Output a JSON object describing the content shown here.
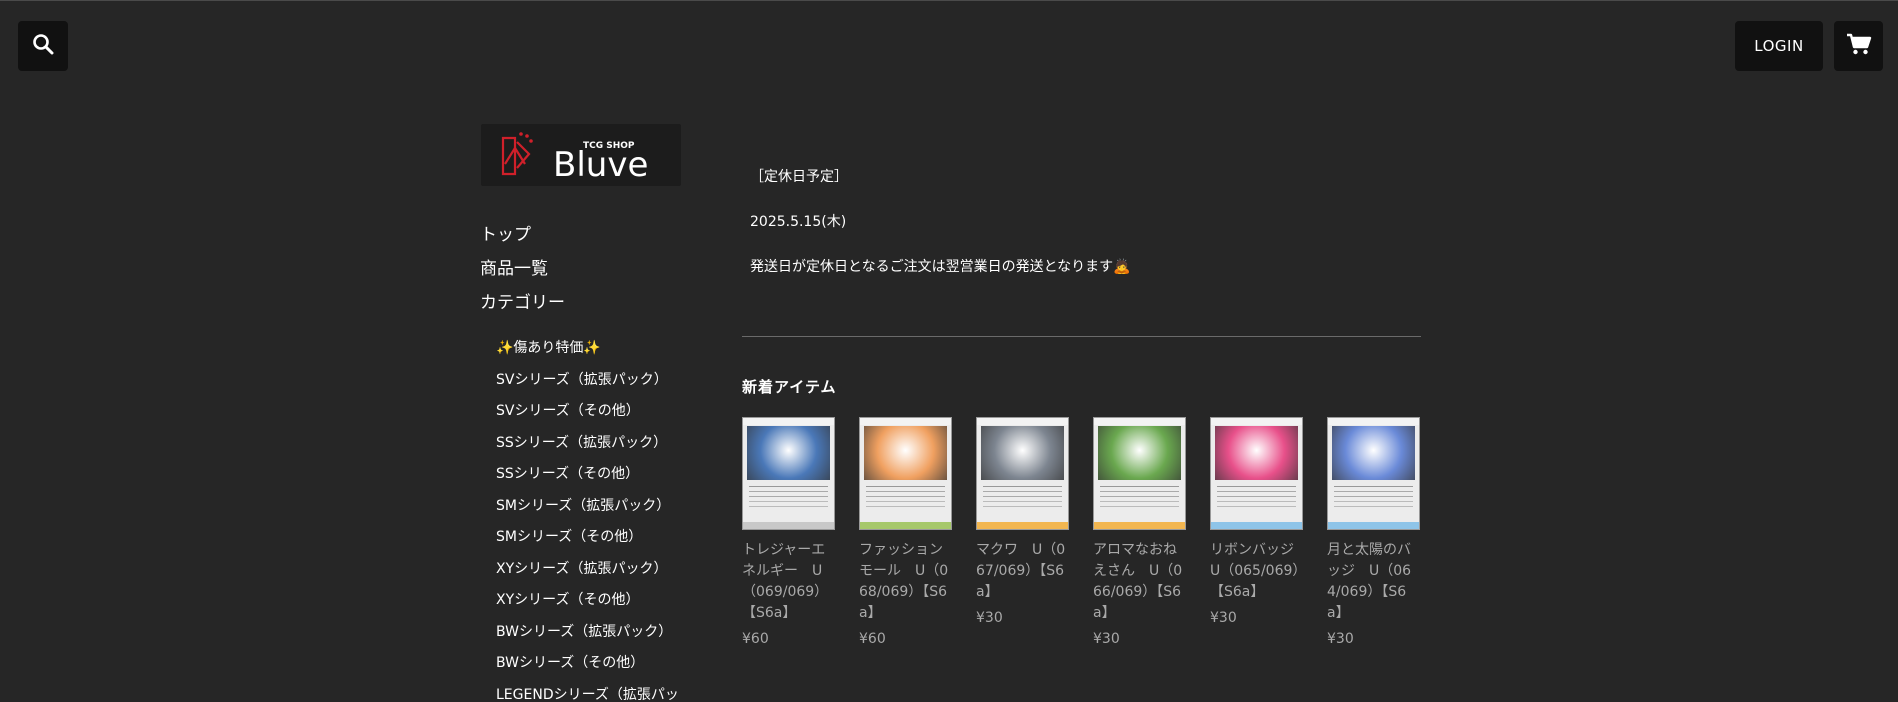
{
  "header": {
    "login_label": "LOGIN",
    "search_icon": "search-icon",
    "cart_icon": "cart-icon"
  },
  "logo": {
    "small_text": "TCG SHOP",
    "brand_text": "Bluve",
    "accent_color": "#d0202a"
  },
  "nav": {
    "items": [
      "トップ",
      "商品一覧",
      "カテゴリー"
    ]
  },
  "categories": [
    "✨傷あり特価✨",
    "SVシリーズ（拡張パック）",
    "SVシリーズ（その他）",
    "SSシリーズ（拡張パック）",
    "SSシリーズ（その他）",
    "SMシリーズ（拡張パック）",
    "SMシリーズ（その他）",
    "XYシリーズ（拡張パック）",
    "XYシリーズ（その他）",
    "BWシリーズ（拡張パック）",
    "BWシリーズ（その他）",
    "LEGENDシリーズ（拡張パッ"
  ],
  "notice": {
    "line1": "［定休日予定］",
    "line2": "2025.5.15(木)",
    "line3": "発送日が定休日となるご注文は翌営業日の発送となります🙇"
  },
  "new_items": {
    "heading": "新着アイテム",
    "products": [
      {
        "name": "トレジャーエネルギー　U（069/069）【S6a】",
        "price": "¥60",
        "art_color": "#4a78b8",
        "bottom_color": "#c8c8c8"
      },
      {
        "name": "ファッションモール　U（068/069）【S6a】",
        "price": "¥60",
        "art_color": "#f0a060",
        "bottom_color": "#a6c86a"
      },
      {
        "name": "マクワ　U（067/069）【S6a】",
        "price": "¥30",
        "art_color": "#7d8590",
        "bottom_color": "#f2b650"
      },
      {
        "name": "アロマなおねえさん　U（066/069）【S6a】",
        "price": "¥30",
        "art_color": "#6aa84f",
        "bottom_color": "#f2b650"
      },
      {
        "name": "リボンバッジ　U（065/069）【S6a】",
        "price": "¥30",
        "art_color": "#e8508a",
        "bottom_color": "#8ec4e8"
      },
      {
        "name": "月と太陽のバッジ　U（064/069）【S6a】",
        "price": "¥30",
        "art_color": "#6a8ad8",
        "bottom_color": "#8ec4e8"
      }
    ]
  }
}
